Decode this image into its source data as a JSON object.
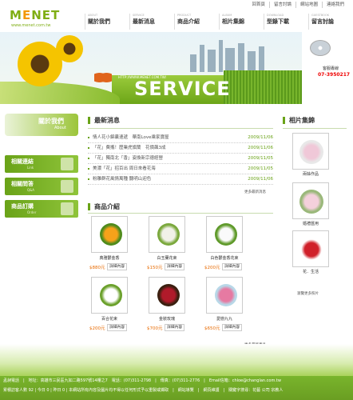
{
  "top_links": [
    "回首頁",
    "留言討論",
    "網站地圖",
    "連絡我們"
  ],
  "logo": {
    "text": "MENET",
    "url": "www.menet.com.tw"
  },
  "nav": [
    {
      "en": "ABOUT",
      "zh": "關於我們"
    },
    {
      "en": "SERVICE",
      "zh": "最新消息"
    },
    {
      "en": "PRODUCT",
      "zh": "商品介紹"
    },
    {
      "en": "ALBUM",
      "zh": "相片集錦"
    },
    {
      "en": "DOWNLOAD",
      "zh": "型錄下載"
    },
    {
      "en": "GUESTBOOK",
      "zh": "留言討論"
    }
  ],
  "banner": {
    "title": "SERVICE",
    "url": "HTTP://WWW.MENET.COM.TW/",
    "hotline_label": "客服專線",
    "hotline": "07-3950217"
  },
  "sidebar": {
    "about_title": "關於我們",
    "about_en": "About",
    "buttons": [
      {
        "zh": "相關連結",
        "en": "Link"
      },
      {
        "zh": "相關問答",
        "en": "Q&A"
      },
      {
        "zh": "商品訂購",
        "en": "Order"
      }
    ]
  },
  "news": {
    "title": "最新消息",
    "items": [
      {
        "text": "情人花小錦囊速遞　華南Love乘家寶屋",
        "date": "2009/11/06"
      },
      {
        "text": "「花」費攜！歷業虎旗蘭　花價飆3成",
        "date": "2009/11/06"
      },
      {
        "text": "「花」獨南北「香」姿換新宗德經營",
        "date": "2009/11/05"
      },
      {
        "text": "美濃「花」招百出 周日來看花海",
        "date": "2009/11/05"
      },
      {
        "text": "粉雕群花風情萬種 聽明山迎色",
        "date": "2009/11/06"
      }
    ],
    "more": "更多最新消息"
  },
  "products": {
    "title": "商品介紹",
    "items": [
      {
        "name": "典雅鬱金香",
        "price": "$880元",
        "detail": "詳細內容"
      },
      {
        "name": "白玉蘭花束",
        "price": "$150元",
        "detail": "詳細內容"
      },
      {
        "name": "白色鬱金香花束",
        "price": "$200元",
        "detail": "詳細內容"
      },
      {
        "name": "百合花束",
        "price": "$200元",
        "detail": "詳細內容"
      },
      {
        "name": "金裝玫瑰",
        "price": "$700元",
        "detail": "詳細內容"
      },
      {
        "name": "愛戀九九",
        "price": "$650元",
        "detail": "詳細內容"
      }
    ],
    "more": "更多最新產品"
  },
  "album": {
    "title": "相片集錦",
    "items": [
      {
        "caption": "兩姊作品"
      },
      {
        "caption": "婚禮匯用"
      },
      {
        "caption": "花．生活"
      }
    ],
    "more": "瀏覽更多照片"
  },
  "footer": {
    "line1": "孟昶電話　|　地址：高雄市三民區九如二路597號14樓之7　電話：(07)311-2798　|　傳真：(07)311-2776　|　Email信箱：chloe@changlan.com.tw",
    "line2": "累積訪客人數 92 | 今日 0 | 昨日 0 | 本網站所有內容及圖片均不得以任何形式予以重製或擷取　|　網站導覽　|　網頁維護　|　關鍵字搜尋：花藝 公司 宗教人"
  },
  "colors": {
    "brand_green": "#6aa318",
    "accent_orange": "#f39800",
    "price_orange": "#e86a00",
    "hotline_red": "#e00000"
  }
}
